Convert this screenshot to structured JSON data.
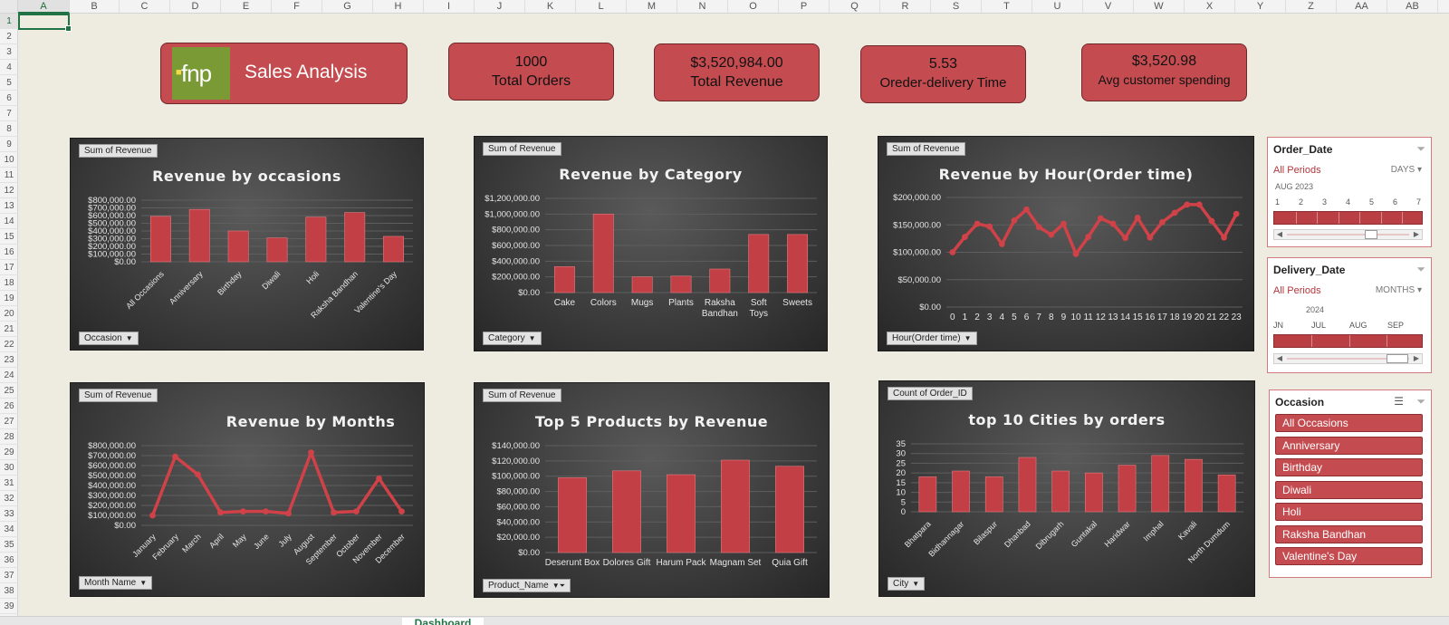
{
  "sheet": {
    "columns": [
      "A",
      "B",
      "C",
      "D",
      "E",
      "F",
      "G",
      "H",
      "I",
      "J",
      "K",
      "L",
      "M",
      "N",
      "O",
      "P",
      "Q",
      "R",
      "S",
      "T",
      "U",
      "V",
      "W",
      "X",
      "Y",
      "Z",
      "AA",
      "AB"
    ],
    "rows": [
      "1",
      "2",
      "3",
      "4",
      "5",
      "6",
      "7",
      "8",
      "9",
      "10",
      "11",
      "12",
      "13",
      "14",
      "15",
      "16",
      "17",
      "18",
      "19",
      "20",
      "21",
      "22",
      "23",
      "24",
      "25",
      "26",
      "27",
      "28",
      "29",
      "30",
      "31",
      "32",
      "33",
      "34",
      "35",
      "36",
      "37",
      "38",
      "39"
    ],
    "active_cell": "A1",
    "active_tab": "Dashboard"
  },
  "header": {
    "logo_text": "fnp",
    "title": "Sales Analysis"
  },
  "kpis": [
    {
      "value": "1000",
      "label": "Total Orders"
    },
    {
      "value": "$3,520,984.00",
      "label": "Total Revenue"
    },
    {
      "value": "5.53",
      "label": "Oreder-delivery Time"
    },
    {
      "value": "$3,520.98",
      "label": "Avg customer spending"
    }
  ],
  "chart_data": [
    {
      "id": "occasions",
      "type": "bar",
      "title": "Revenue by occasions",
      "value_button": "Sum of Revenue",
      "field_button": "Occasion",
      "categories": [
        "All Occasions",
        "Anniversary",
        "Birthday",
        "Diwali",
        "Holi",
        "Raksha Bandhan",
        "Valentine's Day"
      ],
      "values": [
        590000,
        680000,
        400000,
        310000,
        580000,
        640000,
        330000
      ],
      "yticks": [
        "$800,000.00",
        "$700,000.00",
        "$600,000.00",
        "$500,000.00",
        "$400,000.00",
        "$300,000.00",
        "$200,000.00",
        "$100,000.00",
        "$0.00"
      ],
      "ylim": [
        0,
        800000
      ]
    },
    {
      "id": "category",
      "type": "bar",
      "title": "Revenue by Category",
      "value_button": "Sum of Revenue",
      "field_button": "Category",
      "categories": [
        "Cake",
        "Colors",
        "Mugs",
        "Plants",
        "Raksha Bandhan",
        "Soft Toys",
        "Sweets"
      ],
      "values": [
        330000,
        1000000,
        200000,
        210000,
        300000,
        740000,
        740000
      ],
      "yticks": [
        "$1,200,000.00",
        "$1,000,000.00",
        "$800,000.00",
        "$600,000.00",
        "$400,000.00",
        "$200,000.00",
        "$0.00"
      ],
      "ylim": [
        0,
        1200000
      ]
    },
    {
      "id": "hour",
      "type": "line",
      "title": "Revenue by Hour(Order time)",
      "value_button": "Sum of Revenue",
      "field_button": "Hour(Order time)",
      "categories": [
        "0",
        "1",
        "2",
        "3",
        "4",
        "5",
        "6",
        "7",
        "8",
        "9",
        "10",
        "11",
        "12",
        "13",
        "14",
        "15",
        "16",
        "17",
        "18",
        "19",
        "20",
        "21",
        "22",
        "23"
      ],
      "values": [
        100000,
        128000,
        152000,
        147000,
        115000,
        158000,
        178000,
        146000,
        132000,
        152000,
        97000,
        128000,
        162000,
        152000,
        126000,
        163000,
        127000,
        155000,
        172000,
        187000,
        187000,
        157000,
        127000,
        170000
      ],
      "yticks": [
        "$200,000.00",
        "$150,000.00",
        "$100,000.00",
        "$50,000.00",
        "$0.00"
      ],
      "ylim": [
        0,
        200000
      ]
    },
    {
      "id": "months",
      "type": "line",
      "title": "Revenue by Months",
      "value_button": "Sum of Revenue",
      "field_button": "Month Name",
      "categories": [
        "January",
        "February",
        "March",
        "April",
        "May",
        "June",
        "July",
        "August",
        "September",
        "October",
        "November",
        "December"
      ],
      "values": [
        100000,
        690000,
        510000,
        130000,
        140000,
        140000,
        120000,
        730000,
        130000,
        140000,
        470000,
        140000
      ],
      "yticks": [
        "$800,000.00",
        "$700,000.00",
        "$600,000.00",
        "$500,000.00",
        "$400,000.00",
        "$300,000.00",
        "$200,000.00",
        "$100,000.00",
        "$0.00"
      ],
      "ylim": [
        0,
        800000
      ]
    },
    {
      "id": "products",
      "type": "bar",
      "title": "Top 5 Products by Revenue",
      "value_button": "Sum of Revenue",
      "field_button": "Product_Name",
      "categories": [
        "Deserunt Box",
        "Dolores Gift",
        "Harum Pack",
        "Magnam Set",
        "Quia Gift"
      ],
      "values": [
        98000,
        107000,
        102000,
        121000,
        113000
      ],
      "yticks": [
        "$140,000.00",
        "$120,000.00",
        "$100,000.00",
        "$80,000.00",
        "$60,000.00",
        "$40,000.00",
        "$20,000.00",
        "$0.00"
      ],
      "ylim": [
        0,
        140000
      ]
    },
    {
      "id": "cities",
      "type": "bar",
      "title": "top 10 Cities by orders",
      "value_button": "Count of Order_ID",
      "field_button": "City",
      "categories": [
        "Bhatpara",
        "Bidhannagar",
        "Bilaspur",
        "Dhanbad",
        "Dibrugarh",
        "Guntakal",
        "Haridwar",
        "Imphal",
        "Kavali",
        "North Dumdum"
      ],
      "values": [
        18,
        21,
        18,
        28,
        21,
        20,
        24,
        29,
        27,
        19
      ],
      "yticks": [
        "35",
        "30",
        "25",
        "20",
        "15",
        "10",
        "5",
        "0"
      ],
      "ylim": [
        0,
        35
      ]
    }
  ],
  "slicers": {
    "order_date": {
      "title": "Order_Date",
      "all_periods": "All Periods",
      "unit": "DAYS",
      "period": "AUG 2023",
      "ticks": [
        "1",
        "2",
        "3",
        "4",
        "5",
        "6",
        "7"
      ]
    },
    "delivery_date": {
      "title": "Delivery_Date",
      "all_periods": "All Periods",
      "unit": "MONTHS",
      "period": "2024",
      "ticks": [
        "JN",
        "JUL",
        "AUG",
        "SEP"
      ]
    },
    "occasion": {
      "title": "Occasion",
      "items": [
        "All Occasions",
        "Anniversary",
        "Birthday",
        "Diwali",
        "Holi",
        "Raksha Bandhan",
        "Valentine's Day"
      ]
    }
  },
  "colors": {
    "accent": "#c44c50",
    "bar": "#c23f45",
    "line": "#d04248",
    "panel": "#3d3d3d",
    "sheet_bg": "#eeebe0"
  }
}
